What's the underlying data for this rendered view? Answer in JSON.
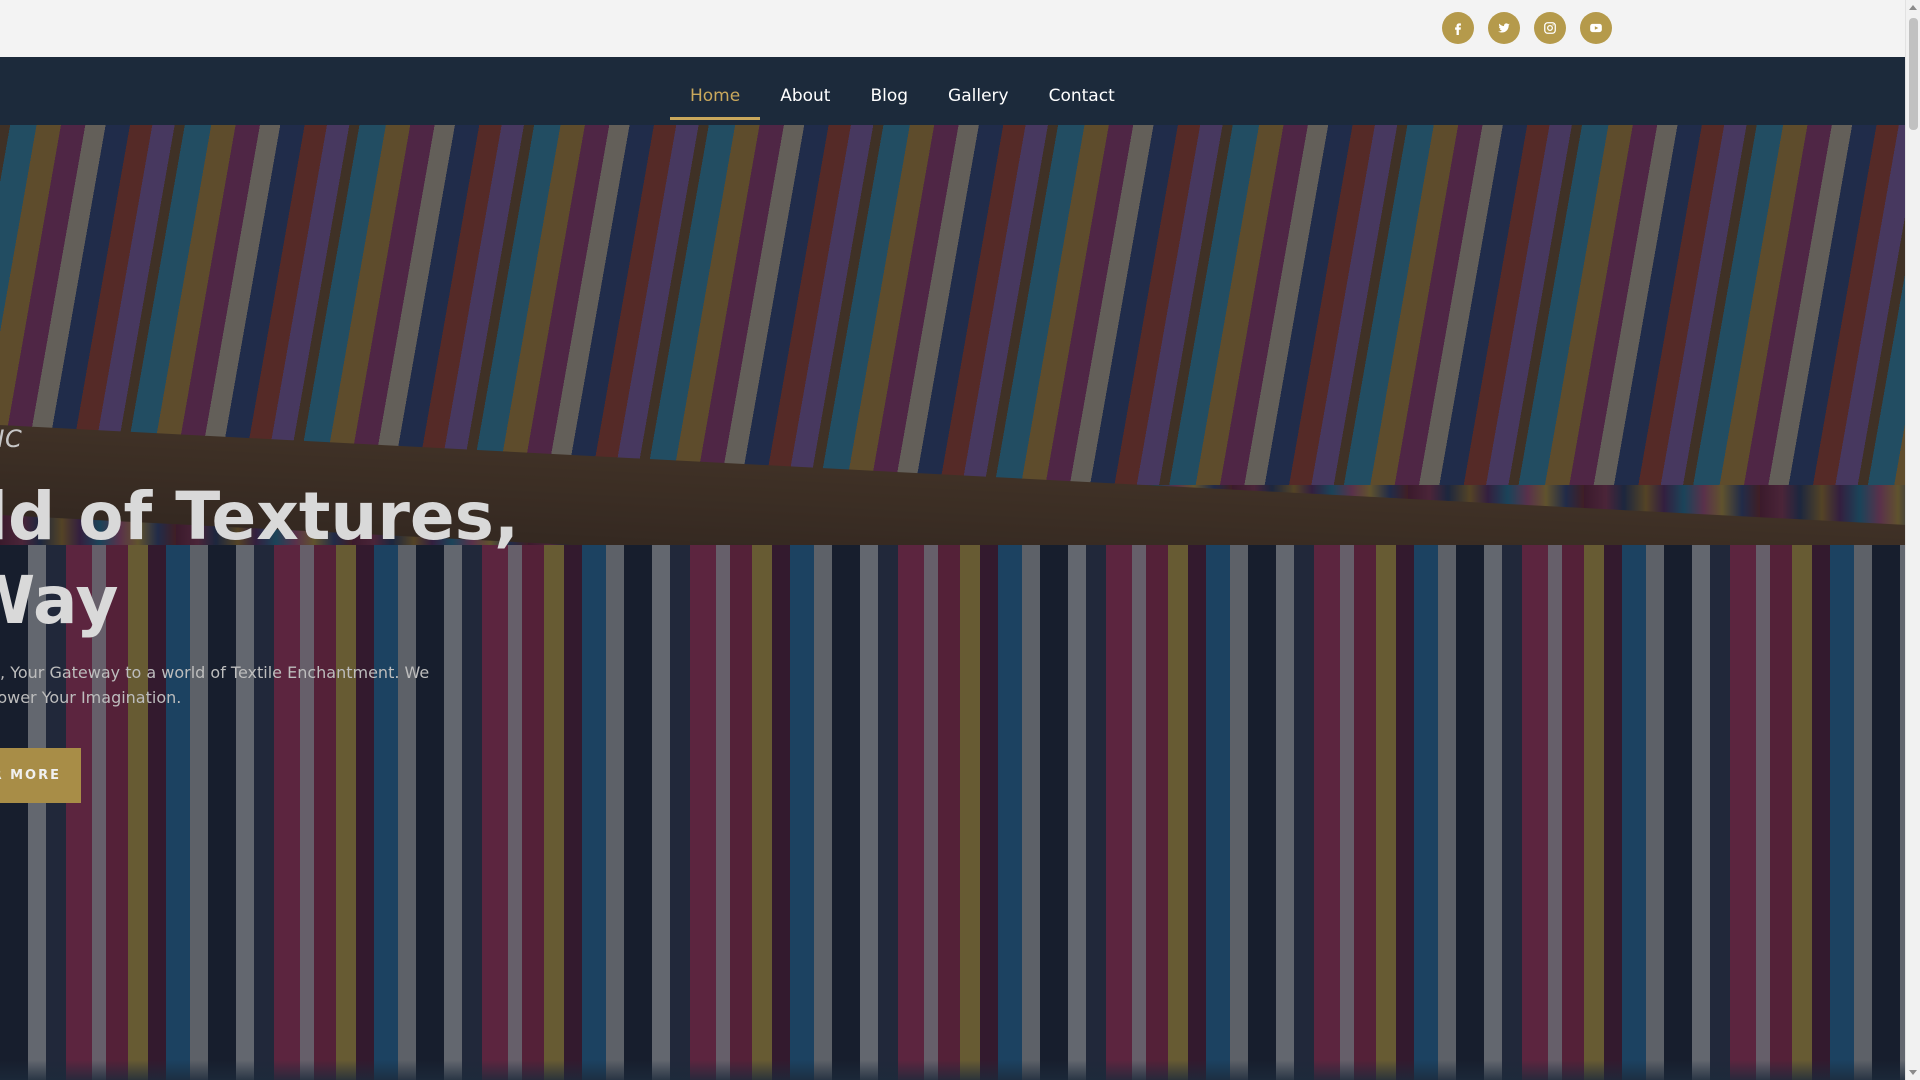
{
  "social": [
    {
      "name": "facebook-icon"
    },
    {
      "name": "twitter-icon"
    },
    {
      "name": "instagram-icon"
    },
    {
      "name": "youtube-icon"
    }
  ],
  "nav": {
    "items": [
      {
        "label": "Home",
        "active": true
      },
      {
        "label": "About",
        "active": false
      },
      {
        "label": "Blog",
        "active": false
      },
      {
        "label": "Gallery",
        "active": false
      },
      {
        "label": "Contact",
        "active": false
      }
    ]
  },
  "hero": {
    "kicker": "NIUM FABRIC",
    "title_line1": "Vorld of Textures,",
    "title_line2": "ur Way",
    "desc_line1": " Millennium Fabric, Your Gateway to a world of Textile Enchantment. We",
    "desc_line2": "ll Fabric, We Empower Your Imagination.",
    "button_label": "R MORE"
  },
  "colors": {
    "accent": "#c9a85c",
    "social_bg": "#b59a4b",
    "nav_bg": "#1c2a3b",
    "button_bg": "#a88d47"
  }
}
